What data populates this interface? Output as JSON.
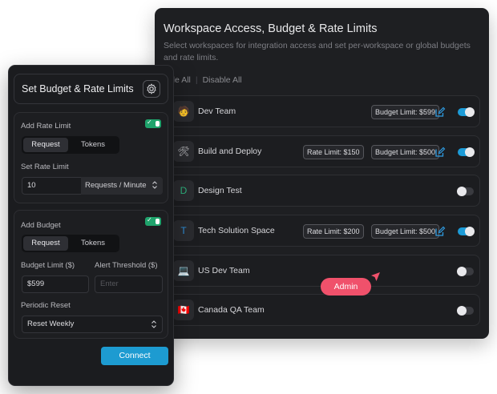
{
  "workspace_panel": {
    "title": "Workspace Access, Budget & Rate Limits",
    "description": "Select workspaces for integration access and set per-workspace or global budgets and rate limits.",
    "select_all_label": "able All",
    "disable_all_label": "Disable All",
    "rows": [
      {
        "name": "Dev Team",
        "icon": "person-emoji-icon",
        "icon_glyph": "🧑",
        "rate_limit": "",
        "budget_limit": "Budget Limit: $599",
        "enabled": true
      },
      {
        "name": "Build and Deploy",
        "icon": "tools-icon",
        "icon_glyph": "🛠",
        "rate_limit": "Rate Limit: $150",
        "budget_limit": "Budget Limit: $500",
        "enabled": true
      },
      {
        "name": "Design Test",
        "icon": "letter-d-icon",
        "icon_glyph": "D",
        "rate_limit": "",
        "budget_limit": "",
        "enabled": false
      },
      {
        "name": "Tech Solution Space",
        "icon": "letter-t-icon",
        "icon_glyph": "T",
        "rate_limit": "Rate Limit: $200",
        "budget_limit": "Budget Limit: $500",
        "enabled": true
      },
      {
        "name": "US Dev Team",
        "icon": "laptop-icon",
        "icon_glyph": "💻",
        "rate_limit": "",
        "budget_limit": "",
        "enabled": false
      },
      {
        "name": "Canada QA Team",
        "icon": "canada-flag-icon",
        "icon_glyph": "🇨🇦",
        "rate_limit": "",
        "budget_limit": "",
        "enabled": false
      }
    ],
    "admin_tag": "Admin"
  },
  "settings_panel": {
    "title": "Set Budget & Rate Limits",
    "rate_limit": {
      "label": "Add Rate Limit",
      "enabled": true,
      "segment": {
        "active": "Request",
        "inactive": "Tokens"
      },
      "field_label": "Set Rate Limit",
      "value": "10",
      "unit": "Requests / Minute"
    },
    "budget": {
      "label": "Add Budget",
      "enabled": true,
      "segment": {
        "active": "Request",
        "inactive": "Tokens"
      },
      "budget_limit_label": "Budget Limit ($)",
      "budget_limit_value": "$599",
      "alert_threshold_label": "Alert Threshold ($)",
      "alert_threshold_placeholder": "Enter",
      "periodic_reset_label": "Periodic Reset",
      "periodic_reset_value": "Reset Weekly"
    },
    "connect_label": "Connect"
  },
  "colors": {
    "accent": "#1d9bd1",
    "toggle_on": "#1c9bd7",
    "mini_toggle": "#1fa36c",
    "admin_tag": "#f0516b",
    "panel_bg": "#1e1f22"
  }
}
